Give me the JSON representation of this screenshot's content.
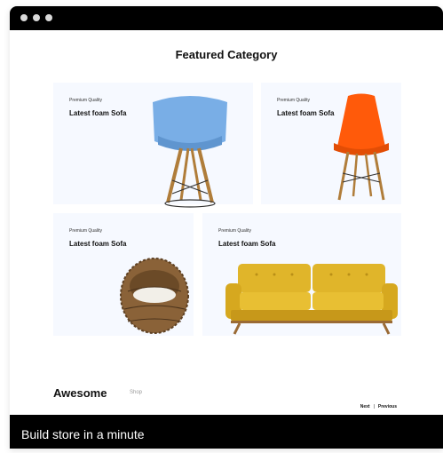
{
  "window": {
    "controls": [
      "dot",
      "dot",
      "dot"
    ]
  },
  "page": {
    "heading": "Featured Category"
  },
  "cards": [
    {
      "kicker": "Premium Quality",
      "title": "Latest foam Sofa",
      "image": "blue-chair"
    },
    {
      "kicker": "Premium Quality",
      "title": "Latest foam Sofa",
      "image": "orange-chair"
    },
    {
      "kicker": "Premium Quality",
      "title": "Latest foam Sofa",
      "image": "wicker-chair"
    },
    {
      "kicker": "Premium Quality",
      "title": "Latest foam Sofa",
      "image": "yellow-sofa"
    }
  ],
  "section": {
    "title": "Awesome",
    "tab": "Shop"
  },
  "pager": {
    "next": "Next",
    "separator": "|",
    "previous": "Previous"
  },
  "footer": {
    "caption": "Build store in a minute"
  },
  "colors": {
    "card_bg": "#f6f9ff",
    "bar": "#000000",
    "blue_chair": "#79aee6",
    "orange_chair": "#ff5a0a",
    "sofa": "#e0b52a",
    "wood": "#b07d3a"
  }
}
